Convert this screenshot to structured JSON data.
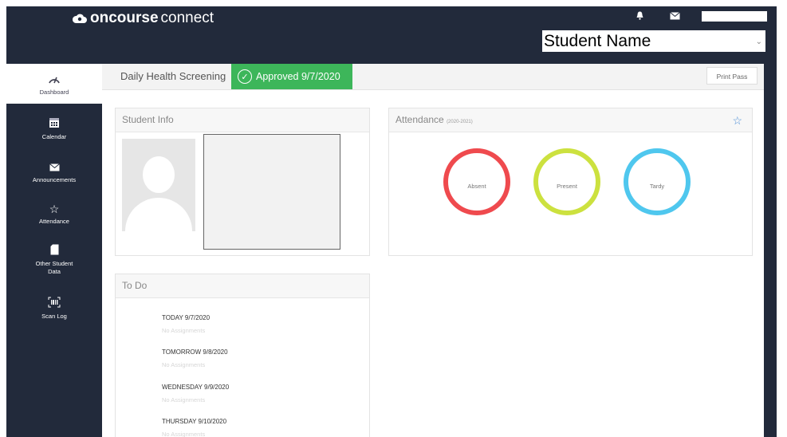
{
  "brand": {
    "bold": "oncourse",
    "light": "connect"
  },
  "header": {
    "student_name": "Student Name"
  },
  "sidebar": {
    "items": [
      {
        "label": "Dashboard",
        "icon": "speedometer-icon"
      },
      {
        "label": "Calendar",
        "icon": "calendar-icon"
      },
      {
        "label": "Announcements",
        "icon": "envelope-icon"
      },
      {
        "label": "Attendance",
        "icon": "star-icon"
      },
      {
        "label": "Other Student Data",
        "icon": "file-icon"
      },
      {
        "label": "Scan Log",
        "icon": "barcode-icon"
      }
    ]
  },
  "topbar": {
    "title": "Daily Health Screening",
    "status": "Approved 9/7/2020",
    "print_label": "Print Pass"
  },
  "student_info": {
    "title": "Student Info"
  },
  "attendance": {
    "title": "Attendance",
    "year": "(2020-2021)",
    "rings": [
      {
        "label": "Absent",
        "color": "#ef4a4e"
      },
      {
        "label": "Present",
        "color": "#cce13f"
      },
      {
        "label": "Tardy",
        "color": "#4fc7ee"
      }
    ]
  },
  "todo": {
    "title": "To Do",
    "days": [
      {
        "day": "TODAY 9/7/2020",
        "note": "No Assignments"
      },
      {
        "day": "TOMORROW 9/8/2020",
        "note": "No Assignments"
      },
      {
        "day": "WEDNESDAY 9/9/2020",
        "note": "No Assignments"
      },
      {
        "day": "THURSDAY 9/10/2020",
        "note": "No Assignments"
      }
    ]
  },
  "colors": {
    "app_bg": "#222a3b",
    "approved": "#3db65a",
    "accent": "#4f8fd6"
  }
}
